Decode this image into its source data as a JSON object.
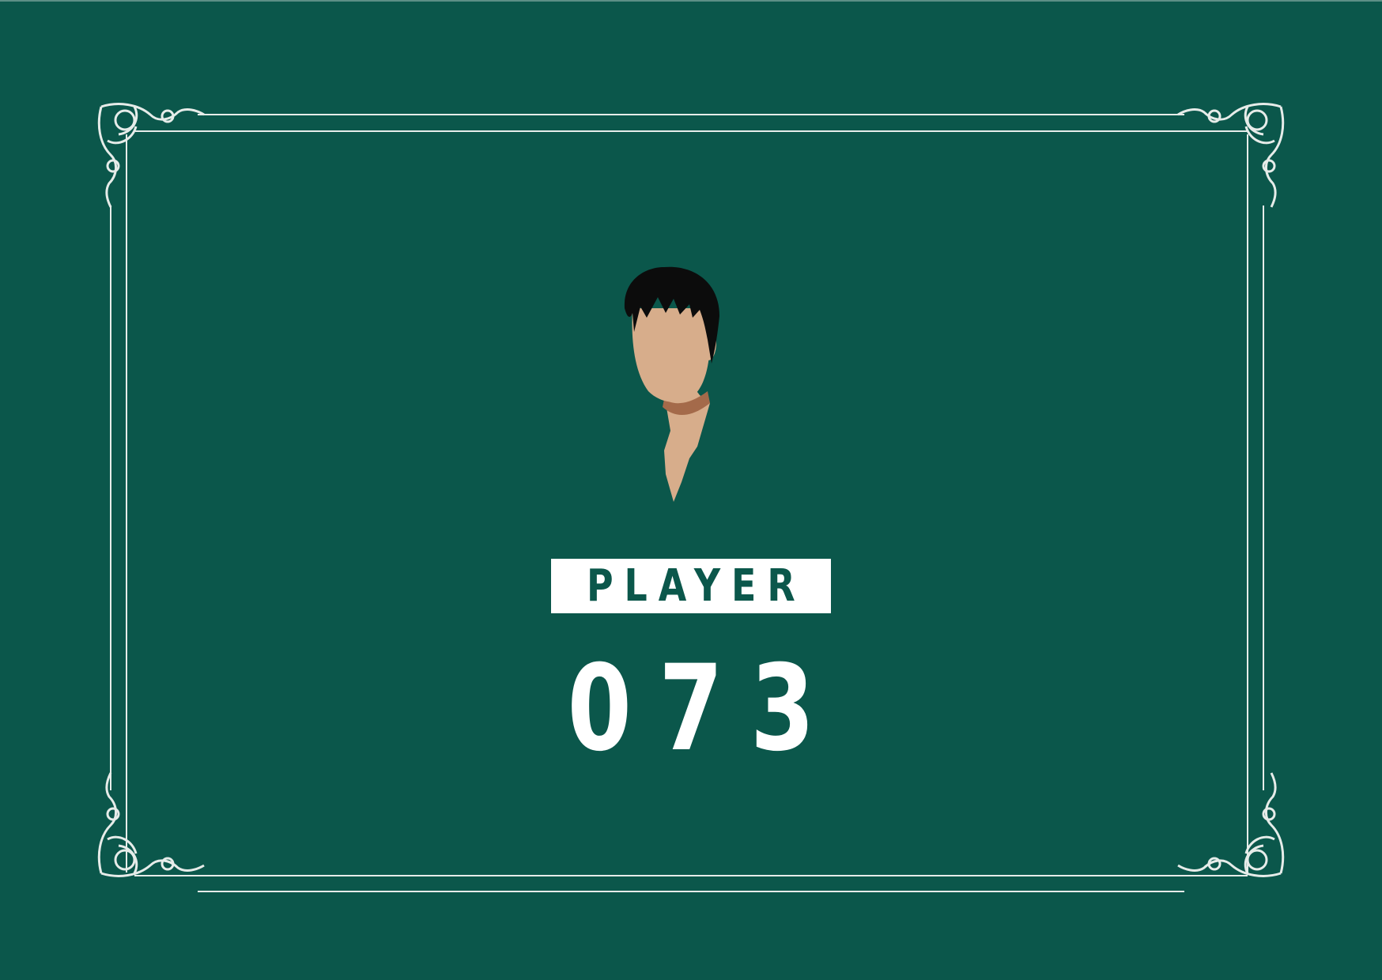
{
  "card": {
    "label": "PLAYER",
    "number": "073"
  },
  "colors": {
    "background": "#0b574b",
    "label_box": "#ffffff",
    "label_text": "#0b574b",
    "number_text": "#ffffff",
    "frame": "#e6ece9",
    "hair": "#0c0c0c",
    "skin": "#d7ad8b",
    "shadow": "#a46a4a"
  },
  "icons": {
    "frame": "ornamental-border-icon",
    "portrait": "faceless-player-portrait"
  }
}
